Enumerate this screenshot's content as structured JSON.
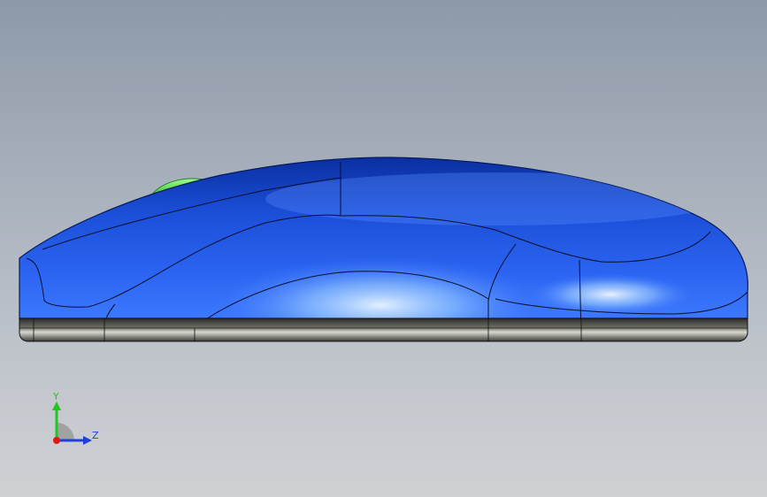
{
  "viewport": {
    "model": "mouse-body",
    "colors": {
      "background_top": "#8e99a8",
      "background_bottom": "#cfd1d4",
      "shell_dark": "#0a2fa0",
      "shell_mid": "#1b4fd8",
      "shell_light": "#3c78ff",
      "highlight": "#bfe1ff",
      "scroll_wheel": "#3fe23a",
      "base_dark": "#2b2b2b",
      "base_light": "#d8d8d0"
    }
  },
  "triad": {
    "y_label": "Y",
    "z_label": "Z",
    "colors": {
      "y_axis": "#22c522",
      "z_axis": "#1f3fd8",
      "origin": "#e01818",
      "plane": "#9a9a9a"
    }
  }
}
